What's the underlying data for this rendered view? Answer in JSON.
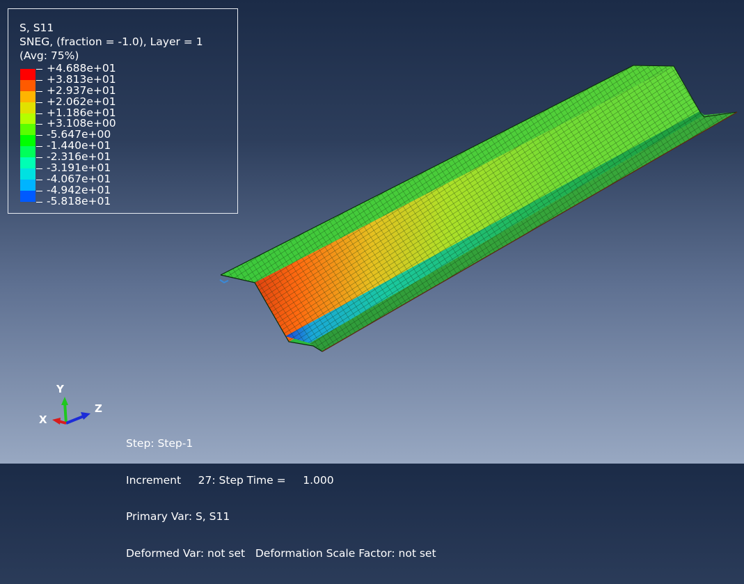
{
  "legend": {
    "title1": "S, S11",
    "title2": "SNEG, (fraction = -1.0), Layer = 1",
    "title3": "(Avg: 75%)",
    "values": [
      "+4.688e+01",
      "+3.813e+01",
      "+2.937e+01",
      "+2.062e+01",
      "+1.186e+01",
      "+3.108e+00",
      "-5.647e+00",
      "-1.440e+01",
      "-2.316e+01",
      "-3.191e+01",
      "-4.067e+01",
      "-4.942e+01",
      "-5.818e+01"
    ],
    "colors": [
      "#ff0000",
      "#ff5a00",
      "#ffb400",
      "#e1e100",
      "#b4ff00",
      "#5aff00",
      "#00ff00",
      "#00ff5a",
      "#00ffb4",
      "#00e1e1",
      "#00b4ff",
      "#005aff",
      "#0000ff"
    ]
  },
  "triad": {
    "x": "X",
    "y": "Y",
    "z": "Z"
  },
  "info": {
    "line1": "Step: Step-1",
    "line2": "Increment     27: Step Time =     1.000",
    "line3": "Primary Var: S, S11",
    "line4": "Deformed Var: not set   Deformation Scale Factor: not set"
  }
}
